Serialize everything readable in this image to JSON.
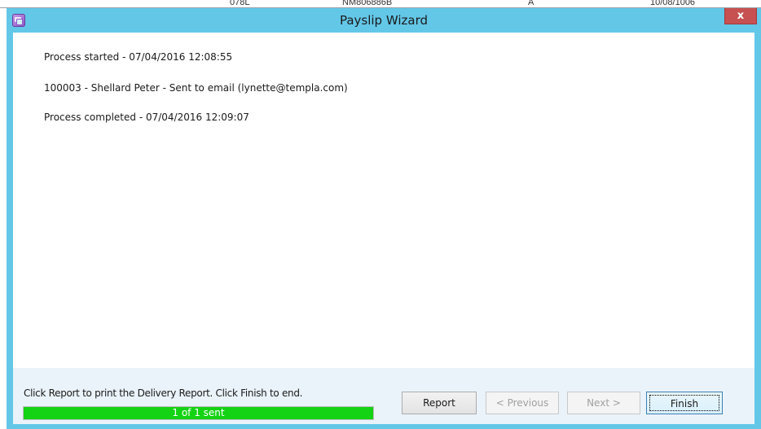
{
  "background": {
    "cells": [
      "078L",
      "NM806886B",
      "A",
      "10/08/1006"
    ]
  },
  "dialog": {
    "title": "Payslip Wizard",
    "close_label": "x"
  },
  "log": [
    "Process started - 07/04/2016 12:08:55",
    "100003 - Shellard Peter  - Sent to email (lynette@templa.com)",
    "Process completed - 07/04/2016 12:09:07"
  ],
  "footer": {
    "instructions": "Click Report to print the Delivery Report. Click Finish to end.",
    "progress_label": "1 of 1 sent",
    "progress_fraction": 1.0
  },
  "buttons": {
    "report": "Report",
    "previous": "< Previous",
    "next": "Next >",
    "finish": "Finish"
  },
  "colors": {
    "titlebar": "#63c7e8",
    "close": "#c75050",
    "progress": "#14d214"
  }
}
